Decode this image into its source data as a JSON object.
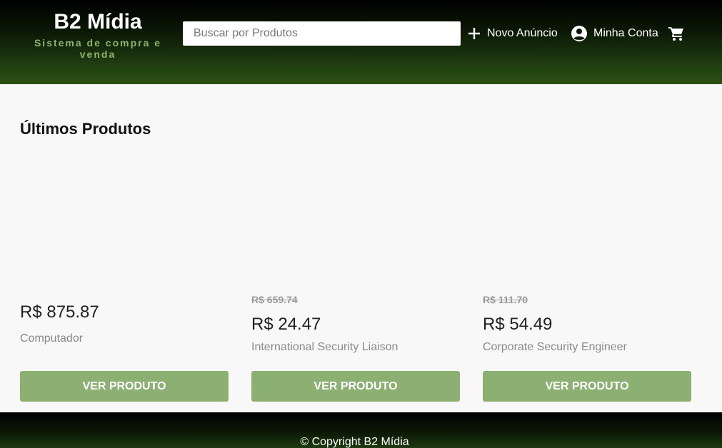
{
  "header": {
    "brand_title": "B2 Mídia",
    "brand_subtitle": "Sistema de compra e venda",
    "search_placeholder": "Buscar por Produtos",
    "nav": {
      "new_ad_label": "Novo Anúncio",
      "account_label": "Minha Conta"
    }
  },
  "main": {
    "section_title": "Últimos Produtos",
    "products": [
      {
        "old_price": "",
        "price": "R$ 875.87",
        "name": "Computador",
        "button_label": "VER PRODUTO"
      },
      {
        "old_price": "R$ 659.74",
        "price": "R$ 24.47",
        "name": "International Security Liaison",
        "button_label": "VER PRODUTO"
      },
      {
        "old_price": "R$ 111.70",
        "price": "R$ 54.49",
        "name": "Corporate Security Engineer",
        "button_label": "VER PRODUTO"
      }
    ]
  },
  "footer": {
    "copyright": "© Copyright B2 Mídia"
  },
  "icons": {
    "add": "plus-icon",
    "account": "account-circle-icon",
    "cart": "shopping-cart-icon"
  },
  "colors": {
    "header_gradient_end": "#2d5217",
    "brand_subtitle": "#8fb36f",
    "button": "#8bb072",
    "background": "#f8f8f8"
  }
}
